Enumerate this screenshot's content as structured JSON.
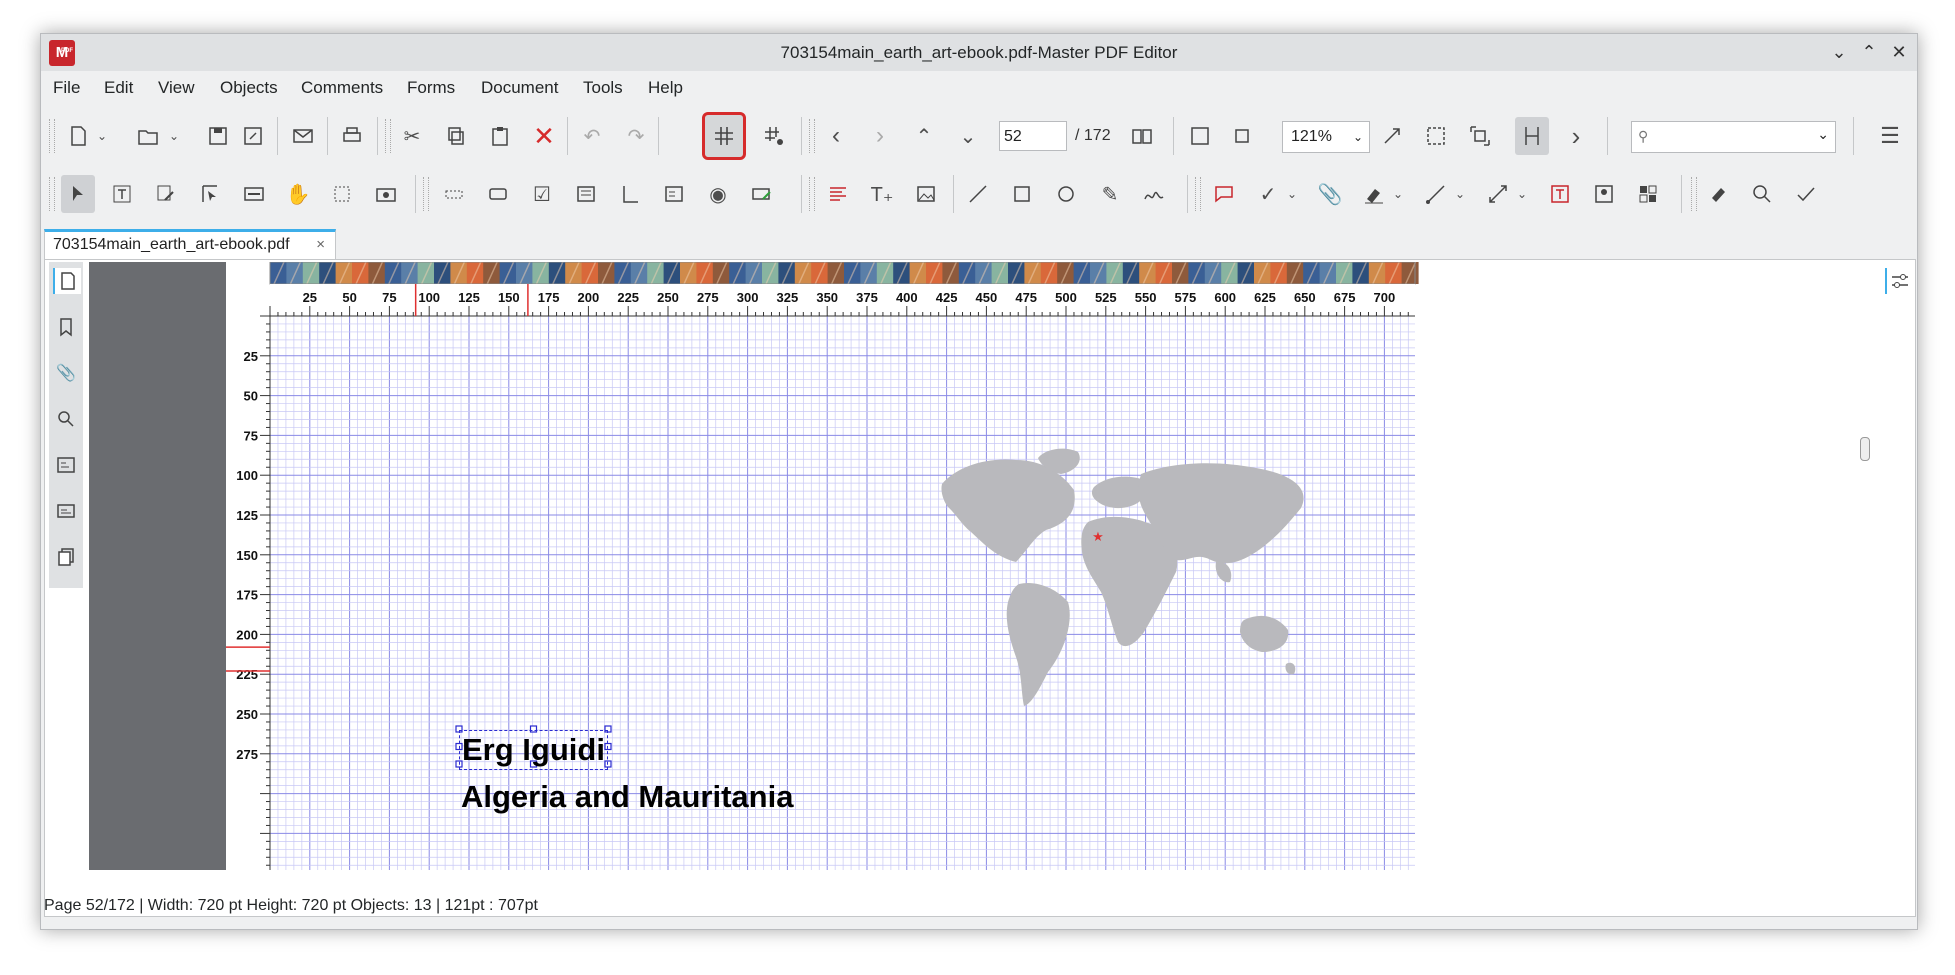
{
  "window": {
    "title": "703154main_earth_art-ebook.pdf-Master PDF Editor",
    "logo_text": "M",
    "logo_badge": "PDF"
  },
  "menu": [
    "File",
    "Edit",
    "View",
    "Objects",
    "Comments",
    "Forms",
    "Document",
    "Tools",
    "Help"
  ],
  "navigation": {
    "current_page": "52",
    "total_pages": "/ 172"
  },
  "zoom": {
    "value": "121%"
  },
  "search": {
    "placeholder": ""
  },
  "tabs": [
    {
      "label": "703154main_earth_art-ebook.pdf",
      "close": "×"
    }
  ],
  "page": {
    "caption_title": "Erg Iguidi",
    "caption_subtitle": "Algeria and Mauritania",
    "ruler_h": [
      "25",
      "50",
      "75",
      "100",
      "125",
      "150",
      "175",
      "200",
      "225",
      "250",
      "275",
      "300",
      "325",
      "350",
      "375",
      "400",
      "425",
      "450",
      "475",
      "500",
      "525",
      "550",
      "575",
      "600",
      "625",
      "650",
      "675",
      "700"
    ],
    "ruler_v": [
      "25",
      "50",
      "75",
      "100",
      "125",
      "150",
      "175",
      "200",
      "225",
      "250",
      "275"
    ],
    "marker_glyph": "★",
    "colors": {
      "grid_minor": "#c8c8f5",
      "grid_major": "#8a8ae6",
      "guide": "#e03030",
      "map": "#b9b9bd",
      "selection": "#2a2ad0"
    }
  },
  "status": {
    "text": "Page 52/172 | Width: 720 pt Height: 720 pt Objects: 13   |   121pt : 707pt"
  }
}
